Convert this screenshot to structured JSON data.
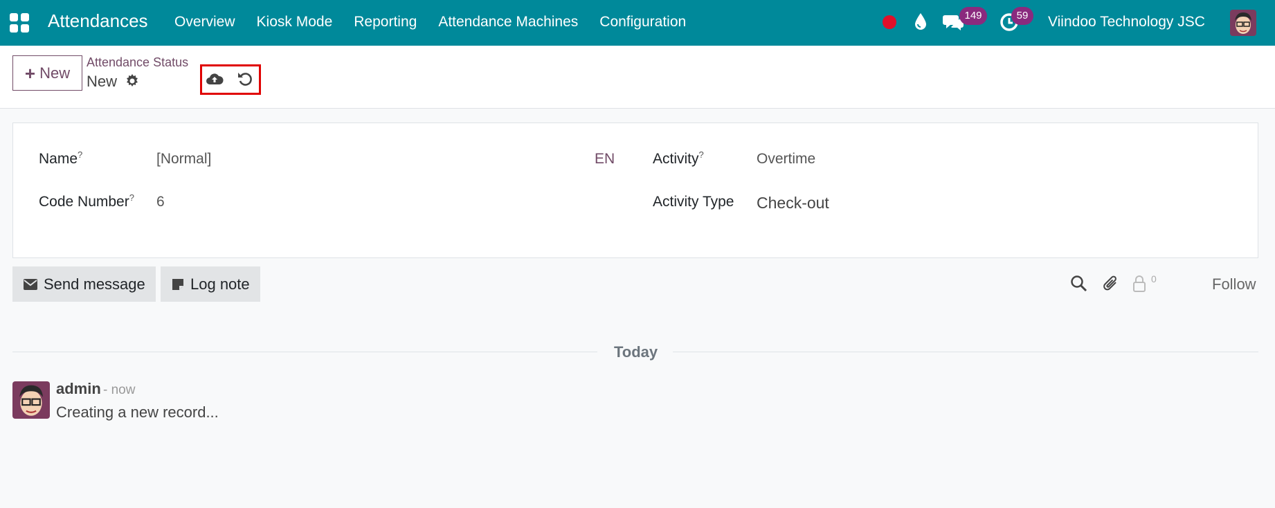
{
  "navbar": {
    "app_title": "Attendances",
    "menu": [
      "Overview",
      "Kiosk Mode",
      "Reporting",
      "Attendance Machines",
      "Configuration"
    ],
    "messages_count": "149",
    "activities_count": "59",
    "company": "Viindoo Technology JSC",
    "color": "#00899a"
  },
  "control": {
    "new_label": "New",
    "breadcrumb": "Attendance Status",
    "record_name": "New"
  },
  "form": {
    "name_label": "Name",
    "name_value": "[Normal]",
    "lang": "EN",
    "code_label": "Code Number",
    "code_value": "6",
    "activity_label": "Activity",
    "activity_value": "Overtime",
    "activity_type_label": "Activity Type",
    "activity_type_value": "Check-out",
    "help_mark": "?"
  },
  "chatter": {
    "send_message": "Send message",
    "log_note": "Log note",
    "followers": "0",
    "follow": "Follow",
    "date_separator": "Today",
    "message": {
      "author": "admin",
      "time": "- now",
      "body": "Creating a new record..."
    }
  },
  "colors": {
    "accent": "#714b67",
    "badge": "#8a2a7e",
    "highlight": "#e00000"
  }
}
